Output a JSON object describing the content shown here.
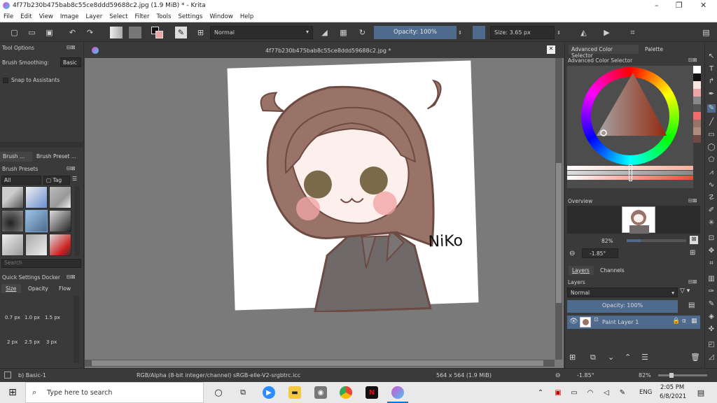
{
  "window": {
    "title": "4f77b230b475bab8c55ce8ddd59688c2.jpg (1.9 MiB)  * - Krita",
    "min": "–",
    "max": "❐",
    "close": "✕"
  },
  "menu": [
    "File",
    "Edit",
    "View",
    "Image",
    "Layer",
    "Select",
    "Filter",
    "Tools",
    "Settings",
    "Window",
    "Help"
  ],
  "toolbar": {
    "blend_mode": "Normal",
    "opacity": "Opacity: 100%",
    "size": "Size: 3.65 px"
  },
  "tool_options": {
    "title": "Tool Options",
    "smoothing_label": "Brush Smoothing:",
    "smoothing_value": "Basic",
    "snap_label": "Snap to Assistants"
  },
  "brush_tabs": [
    "Brush ...",
    "Brush Preset ..."
  ],
  "brush_presets": {
    "title": "Brush Presets",
    "filter": "All",
    "tag": "Tag",
    "search_placeholder": "Search"
  },
  "quick_settings": {
    "title": "Quick Settings Docker",
    "tabs": [
      "Size",
      "Opacity",
      "Flow"
    ],
    "sizes_row1": [
      "0.7 px",
      "1.0 px",
      "1.5 px"
    ],
    "sizes_row2": [
      "2 px",
      "2.5 px",
      "3 px"
    ]
  },
  "document": {
    "tab_title": "4f77b230b475bab8c55ce8ddd59688c2.jpg *",
    "signature": "NiKo"
  },
  "right_panel": {
    "tabs": [
      "Advanced Color Selector",
      "Palette"
    ],
    "color_title": "Advanced Color Selector",
    "overview_title": "Overview",
    "zoom": "82%",
    "rotation": "-1.85°",
    "layer_tabs": [
      "Layers",
      "Channels"
    ],
    "layers_title": "Layers",
    "blend_mode": "Normal",
    "opacity": "Opacity:  100%",
    "layer_name": "Paint Layer 1"
  },
  "status": {
    "brush": "b) Basic-1",
    "color_space": "RGB/Alpha (8-bit integer/channel)  sRGB-elle-V2-srgbtrc.icc",
    "dimensions": "564 x 564 (1.9 MiB)",
    "rotation": "-1.85°",
    "zoom": "82%"
  },
  "taskbar": {
    "search_placeholder": "Type here to search",
    "lang": "ENG",
    "time": "2:05 PM",
    "date": "6/8/2021"
  },
  "colors": {
    "accent": "#4e6a8c",
    "hair": "#9a7368",
    "outline": "#6d4a42",
    "skin": "#fdf0ec",
    "shirt": "#6f6a69",
    "blush": "#f0a5a5",
    "eyes": "#7a6a4a"
  }
}
